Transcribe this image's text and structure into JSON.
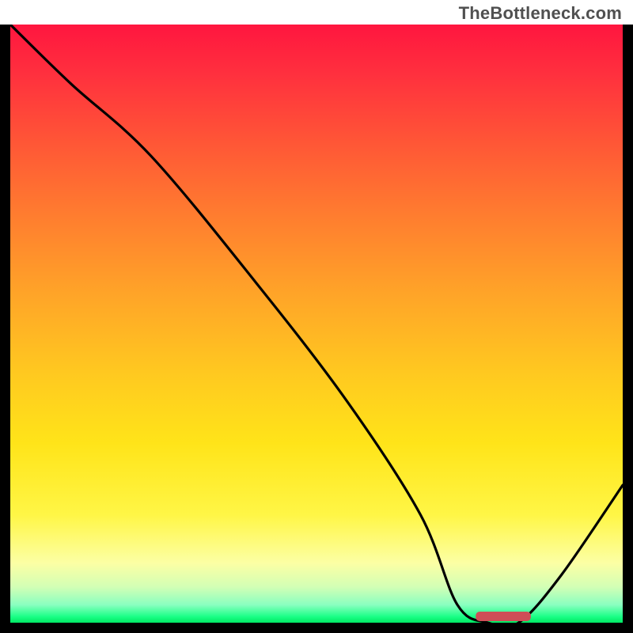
{
  "watermark": "TheBottleneck.com",
  "colors": {
    "curve": "#000000",
    "marker": "#cf4e57",
    "frame": "#000000"
  },
  "chart_data": {
    "type": "line",
    "title": "",
    "xlabel": "",
    "ylabel": "",
    "xlim": [
      0,
      100
    ],
    "ylim": [
      0,
      100
    ],
    "grid": false,
    "legend": false,
    "series": [
      {
        "name": "bottleneck-curve",
        "x": [
          0,
          10,
          23,
          40,
          55,
          67,
          73,
          78,
          83,
          90,
          100
        ],
        "y": [
          100,
          90,
          78,
          57,
          37,
          18,
          3,
          0,
          0,
          8,
          23
        ]
      }
    ],
    "marker": {
      "name": "optimal-range",
      "x_start": 76,
      "x_end": 85,
      "y": 0
    },
    "background_gradient_stops": [
      {
        "pos": 0,
        "color": "#ff163f"
      },
      {
        "pos": 20,
        "color": "#ff5736"
      },
      {
        "pos": 45,
        "color": "#ffa428"
      },
      {
        "pos": 70,
        "color": "#ffe419"
      },
      {
        "pos": 90,
        "color": "#fcffa4"
      },
      {
        "pos": 100,
        "color": "#00e763"
      }
    ]
  }
}
